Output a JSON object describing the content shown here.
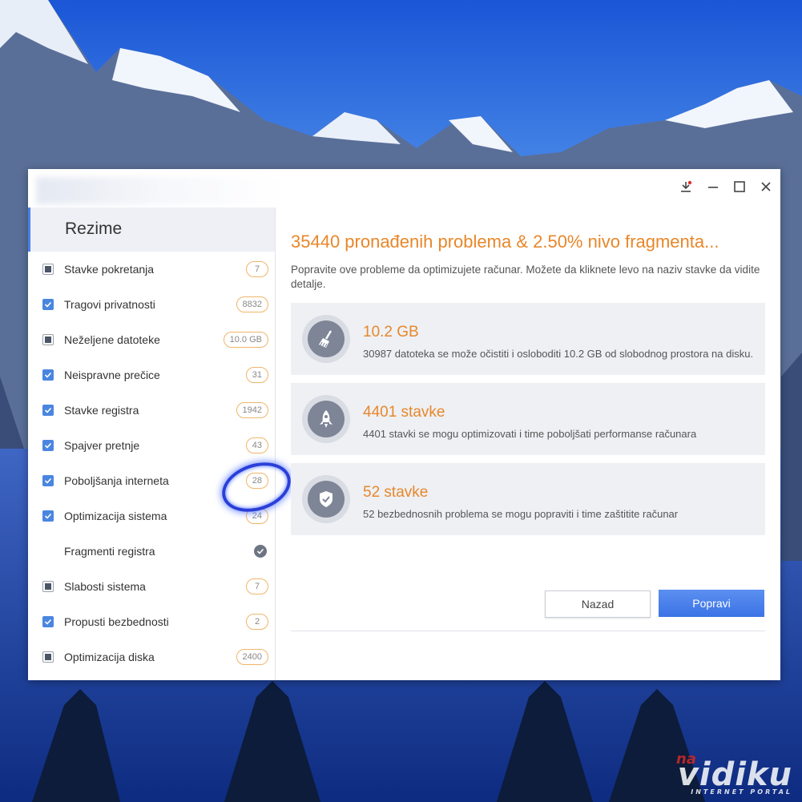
{
  "window": {
    "title_icons": [
      "download-icon",
      "minimize-icon",
      "maximize-icon",
      "close-icon"
    ]
  },
  "sidebar": {
    "title": "Rezime",
    "items": [
      {
        "label": "Stavke pokretanja",
        "state": "partial",
        "badge": "7"
      },
      {
        "label": "Tragovi privatnosti",
        "state": "checked",
        "badge": "8832"
      },
      {
        "label": "Neželjene datoteke",
        "state": "partial",
        "badge": "10.0 GB"
      },
      {
        "label": "Neispravne prečice",
        "state": "checked",
        "badge": "31"
      },
      {
        "label": "Stavke registra",
        "state": "checked",
        "badge": "1942"
      },
      {
        "label": "Spajver pretnje",
        "state": "checked",
        "badge": "43"
      },
      {
        "label": "Poboljšanja interneta",
        "state": "checked",
        "badge": "28"
      },
      {
        "label": "Optimizacija sistema",
        "state": "checked",
        "badge": "24"
      },
      {
        "label": "Fragmenti registra",
        "state": "none",
        "badge": ""
      },
      {
        "label": "Slabosti sistema",
        "state": "partial",
        "badge": "7"
      },
      {
        "label": "Propusti bezbednosti",
        "state": "checked",
        "badge": "2"
      },
      {
        "label": "Optimizacija diska",
        "state": "partial",
        "badge": "2400"
      }
    ]
  },
  "main": {
    "headline": "35440 pronađenih problema & 2.50%  nivo fragmenta...",
    "subtext": "Popravite ove probleme da optimizujete računar. Možete da kliknete levo  na naziv stavke da vidite detalje.",
    "cards": [
      {
        "icon": "broom-icon",
        "title": "10.2 GB",
        "desc": "30987 datoteka se može očistiti i osloboditi  10.2 GB  od slobodnog prostora na disku."
      },
      {
        "icon": "rocket-icon",
        "title": "4401 stavke",
        "desc": "4401 stavki  se mogu optimizovati i time poboljšati performanse računara"
      },
      {
        "icon": "shield-icon",
        "title": "52 stavke",
        "desc": "52 bezbednosnih problema se mogu popraviti i time zaštitite računar"
      }
    ],
    "back_label": "Nazad",
    "fix_label": "Popravi"
  },
  "watermark": {
    "top": "na",
    "main": "vidiku",
    "sub": "INTERNET PORTAL"
  },
  "colors": {
    "accent_orange": "#e8872a",
    "accent_blue": "#4a86e0",
    "highlight_ring": "#2a3fd8"
  }
}
